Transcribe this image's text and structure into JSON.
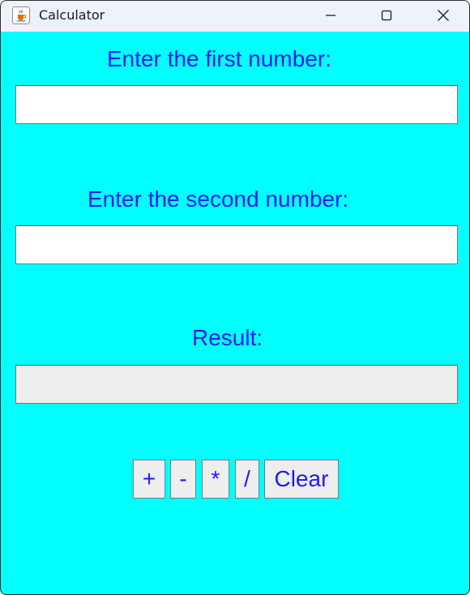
{
  "window": {
    "title": "Calculator",
    "app_icon": "java-cup-icon",
    "controls": [
      "minimize-icon",
      "maximize-icon",
      "close-icon"
    ]
  },
  "form": {
    "first_label": "Enter the first number:",
    "first_value": "",
    "second_label": "Enter the second number:",
    "second_value": "",
    "result_label": "Result:",
    "result_value": ""
  },
  "buttons": {
    "add": "+",
    "subtract": "-",
    "multiply": "*",
    "divide": "/",
    "clear": "Clear"
  },
  "colors": {
    "background": "#00ffff",
    "text": "#1a1aff",
    "field": "#ffffff",
    "result_field": "#eeeeee",
    "button": "#eeeeee"
  }
}
